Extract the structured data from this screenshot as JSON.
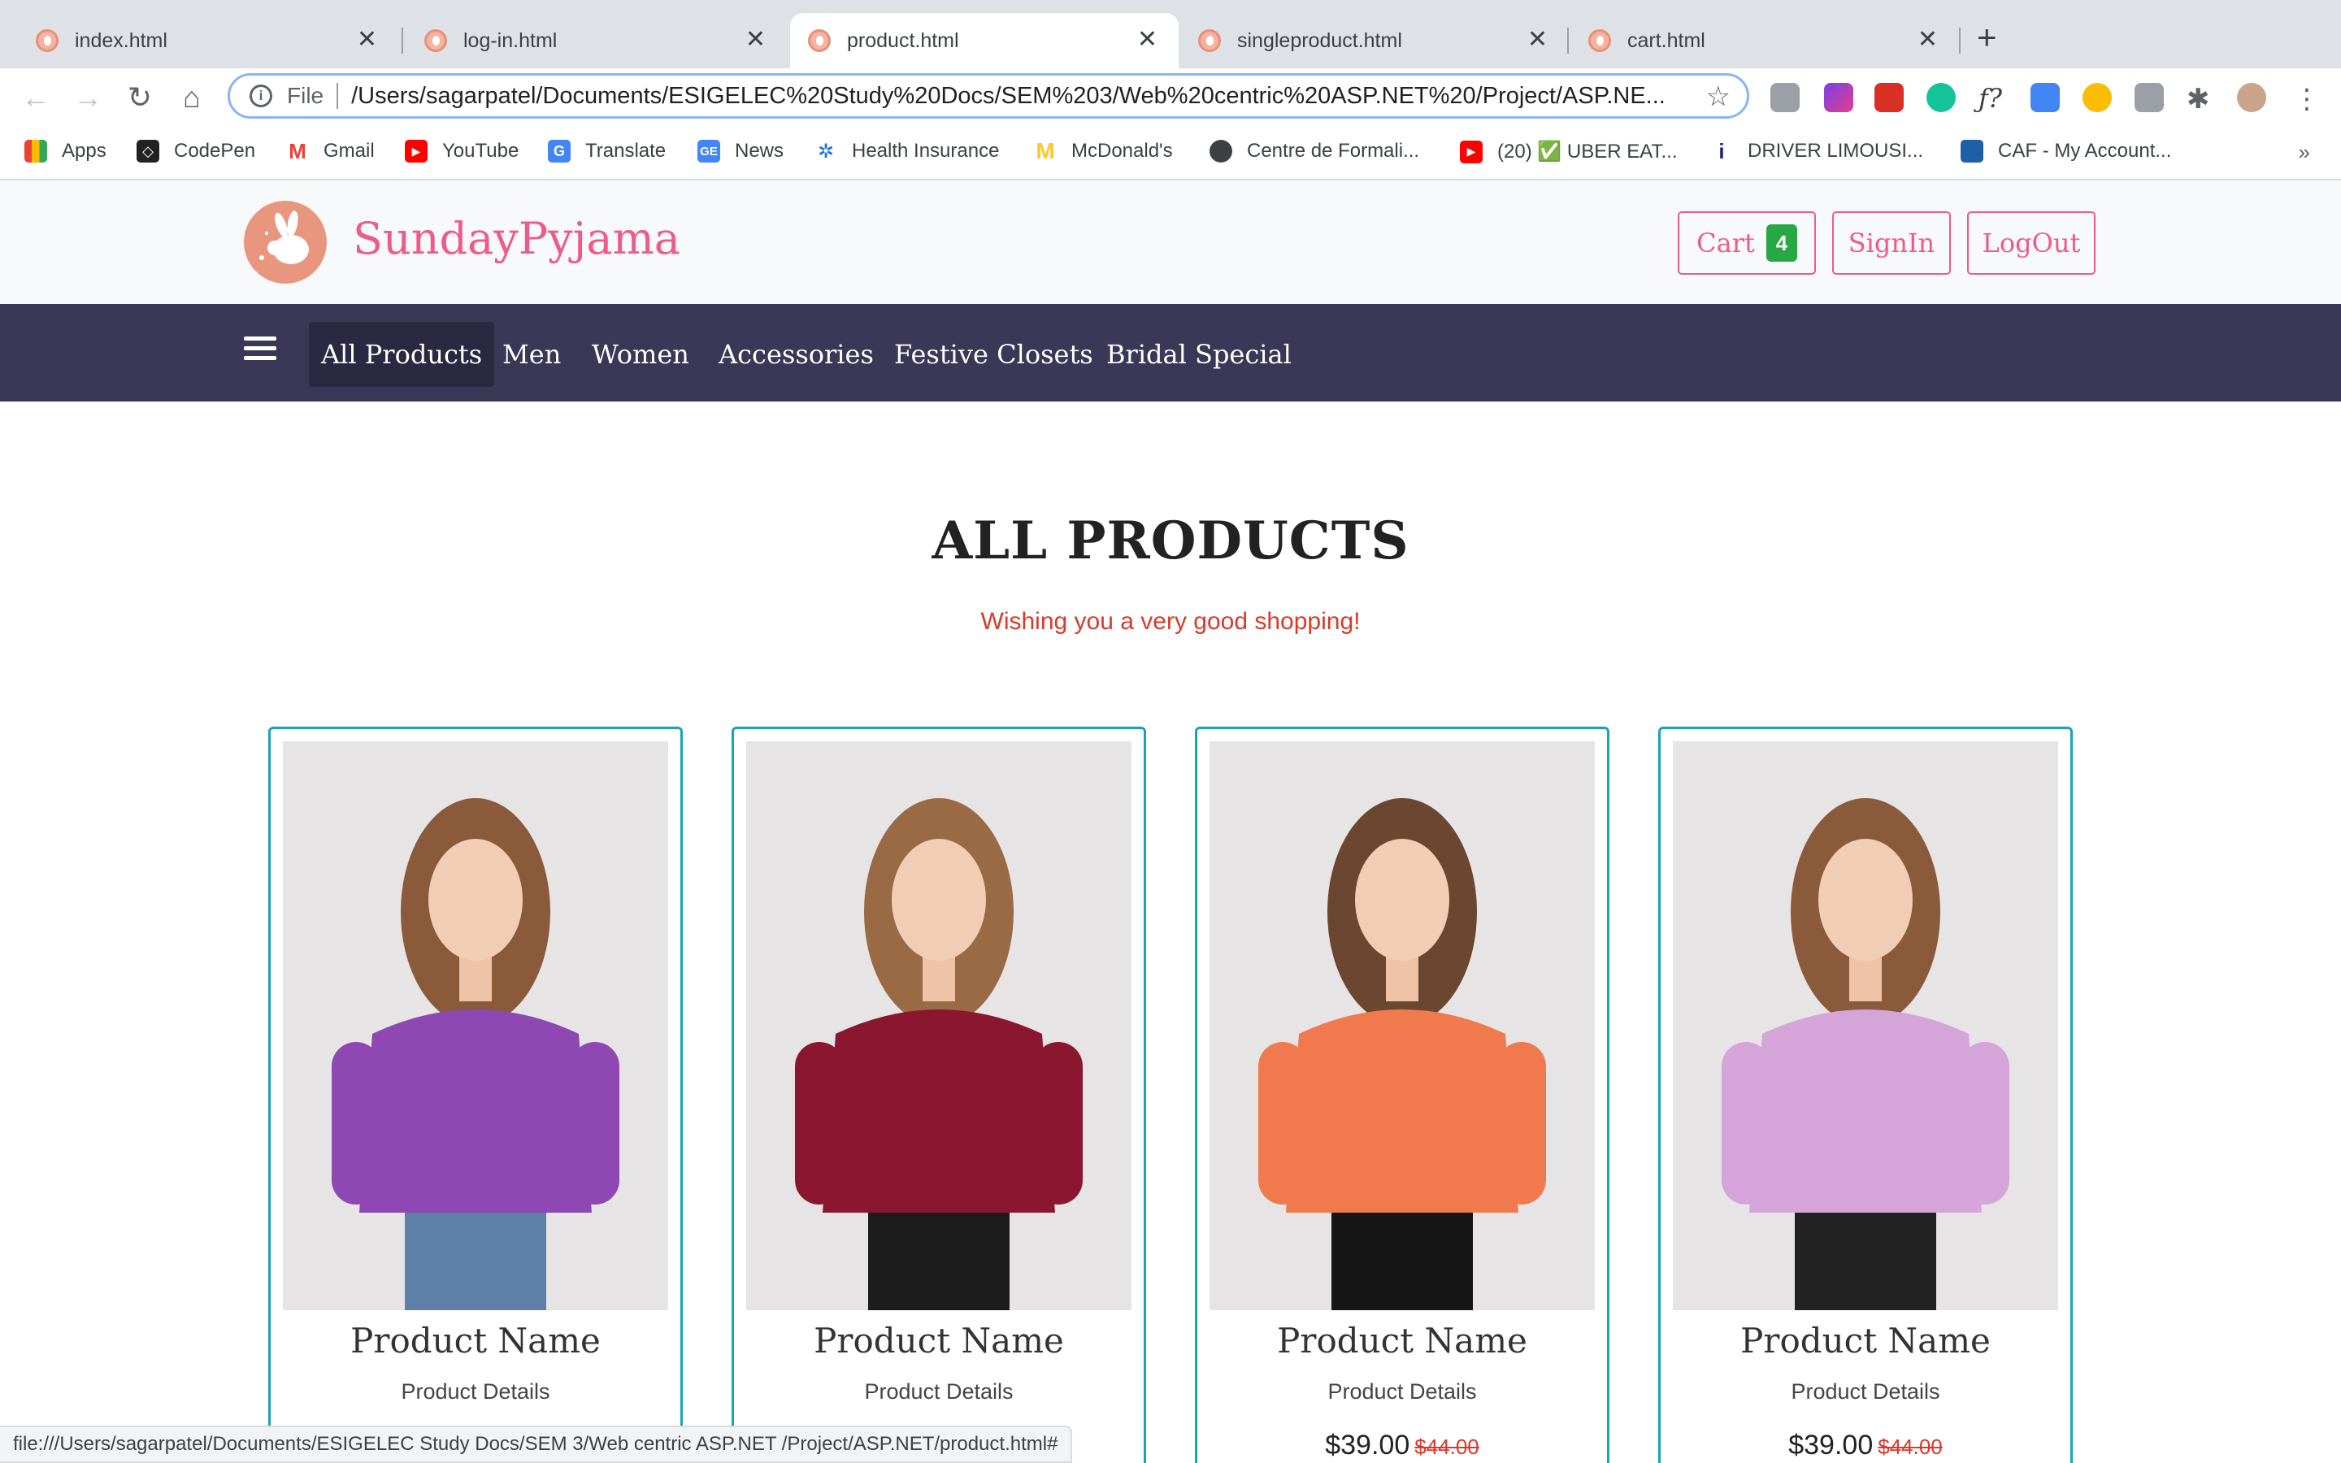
{
  "browser": {
    "tabs": [
      {
        "title": "index.html"
      },
      {
        "title": "log-in.html"
      },
      {
        "title": "product.html"
      },
      {
        "title": "singleproduct.html"
      },
      {
        "title": "cart.html"
      }
    ],
    "active_tab": 2,
    "address": {
      "scheme_label": "File",
      "url": "/Users/sagarpatel/Documents/ESIGELEC%20Study%20Docs/SEM%203/Web%20centric%20ASP.NET%20/Project/ASP.NE..."
    },
    "bookmarks": [
      {
        "label": "Apps",
        "icon": "apps-grid-icon"
      },
      {
        "label": "CodePen",
        "icon": "codepen-icon"
      },
      {
        "label": "Gmail",
        "icon": "gmail-icon"
      },
      {
        "label": "YouTube",
        "icon": "youtube-icon"
      },
      {
        "label": "Translate",
        "icon": "translate-icon"
      },
      {
        "label": "News",
        "icon": "news-icon"
      },
      {
        "label": "Health Insurance",
        "icon": "health-insurance-icon"
      },
      {
        "label": "McDonald's",
        "icon": "mcdonalds-icon"
      },
      {
        "label": "Centre de Formali...",
        "icon": "globe-icon"
      },
      {
        "label": "(20) ✅ UBER EAT...",
        "icon": "youtube-icon"
      },
      {
        "label": "DRIVER LIMOUSI...",
        "icon": "info-icon"
      },
      {
        "label": "CAF - My Account...",
        "icon": "caf-icon"
      }
    ],
    "status_url": "file:///Users/sagarpatel/Documents/ESIGELEC Study Docs/SEM 3/Web centric ASP.NET /Project/ASP.NET/product.html#"
  },
  "site": {
    "brand": "SundayPyjama",
    "header_buttons": {
      "cart": "Cart",
      "cart_count": "4",
      "signin": "SignIn",
      "logout": "LogOut"
    },
    "categories": [
      "All Products",
      "Men",
      "Women",
      "Accessories",
      "Festive Closets",
      "Bridal Special"
    ],
    "active_category": 0,
    "heading": "ALL PRODUCTS",
    "subheading": "Wishing you a very good shopping!",
    "products": [
      {
        "name": "Product Name",
        "details": "Product Details",
        "price": "",
        "old_price": "",
        "sweater_color": "#8e47b3",
        "pants_color": "#5d7fa8",
        "hair_color": "#8a5a3a"
      },
      {
        "name": "Product Name",
        "details": "Product Details",
        "price": "",
        "old_price": "",
        "sweater_color": "#8b1630",
        "pants_color": "#1c1c1c",
        "hair_color": "#9a6a45"
      },
      {
        "name": "Product Name",
        "details": "Product Details",
        "price": "$39.00",
        "old_price": "$44.00",
        "sweater_color": "#f07a4e",
        "pants_color": "#161616",
        "hair_color": "#6b4630"
      },
      {
        "name": "Product Name",
        "details": "Product Details",
        "price": "$39.00",
        "old_price": "$44.00",
        "sweater_color": "#d5a4d8",
        "pants_color": "#222222",
        "hair_color": "#8a5a3a"
      }
    ]
  },
  "colors": {
    "brand_pink": "#ee5b8b",
    "nav_bg": "#3b3857",
    "card_border": "#1aa3b8",
    "subtitle_red": "#d93a2b",
    "badge_green": "#28a745"
  }
}
